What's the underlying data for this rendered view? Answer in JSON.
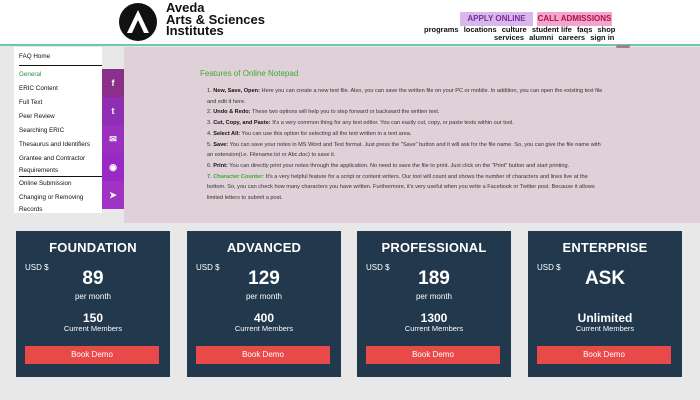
{
  "header": {
    "logo_lines": [
      "Aveda",
      "Arts & Sciences",
      "Institutes"
    ],
    "apply_label": "APPLY ONLINE",
    "call_label": "CALL ADMISSIONS",
    "nav_row1": [
      "programs",
      "locations",
      "culture",
      "student life",
      "faqs",
      "shop"
    ],
    "nav_row2": [
      "services",
      "alumni",
      "careers",
      "sign in"
    ]
  },
  "sidebar": {
    "items": [
      "FAQ Home",
      "General",
      "ERIC Content",
      "Full Text",
      "Peer Review",
      "Searching ERIC",
      "Thesaurus and Identifiers",
      "Grantee and Contractor",
      "Requirements",
      "Online Submission",
      "Changing or Removing",
      "Records"
    ]
  },
  "share": {
    "facebook": "f",
    "twitter": "t",
    "email": "✉",
    "whatsapp": "◉",
    "telegram": "➤",
    "colors": [
      "#8a2f8a",
      "#8f2db3",
      "#9a2fc0",
      "#9a28c5",
      "#a032c6"
    ]
  },
  "content": {
    "title": "Features of Online Notepad",
    "items": [
      {
        "lead": "New, Save, Open:",
        "text": " Here you can create a new text file. Also, you can save the written file on your PC or mobile. In addition, you can open the existing text file and edit it here."
      },
      {
        "lead": "Undo & Redo:",
        "text": " These two options will help you to step forward or backward the written text."
      },
      {
        "lead": "Cut, Copy, and Paste:",
        "text": " It's a very common thing for any text editor. You can easily cut, copy, or paste texts within our tool."
      },
      {
        "lead": "Select All:",
        "text": " You can use this option for selecting all the text written in a text area."
      },
      {
        "lead": "Save:",
        "text": " You can save your notes in MS Word and Text format. Just press the \"Save\" button and it will ask for the file name. So, you can give the file name with an extension(i.e. Filename.txt or Abc.doc) to save it."
      },
      {
        "lead": "Print:",
        "text": " You can directly print your notes through the application. No need to save the file to print. Just click on the \"Print\" button and start printing."
      },
      {
        "lead": "Character Counter:",
        "text": " It's a very helpful feature for a script or content writers. Our tool will count and shows the number of characters and lines live at the bottom. So, you can check how many characters you have written. Furthermore, it's very useful when you write a Facebook or Twitter post. Because it allows limited letters to submit a post."
      }
    ]
  },
  "pricing": [
    {
      "plan": "FOUNDATION",
      "currency": "USD $",
      "price": "89",
      "period": "per month",
      "members": "150",
      "members_label": "Current Members",
      "button": "Book Demo"
    },
    {
      "plan": "ADVANCED",
      "currency": "USD $",
      "price": "129",
      "period": "per month",
      "members": "400",
      "members_label": "Current Members",
      "button": "Book Demo"
    },
    {
      "plan": "PROFESSIONAL",
      "currency": "USD $",
      "price": "189",
      "period": "per month",
      "members": "1300",
      "members_label": "Current Members",
      "button": "Book Demo"
    },
    {
      "plan": "ENTERPRISE",
      "currency": "USD $",
      "price": "ASK",
      "period": "",
      "members": "Unlimited",
      "members_label": "Current Members",
      "button": "Book Demo"
    }
  ]
}
